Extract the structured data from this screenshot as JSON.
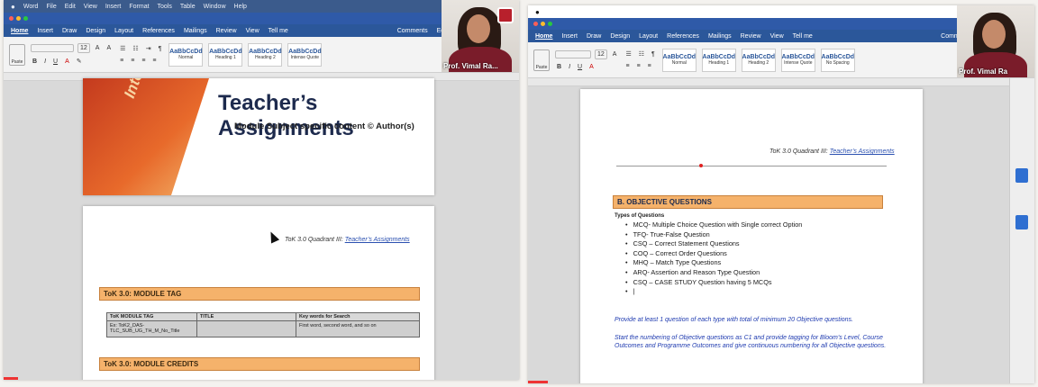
{
  "menubar": {
    "items": [
      "Word",
      "File",
      "Edit",
      "View",
      "Insert",
      "Format",
      "Tools",
      "Table",
      "Window",
      "Help"
    ]
  },
  "ribbon": {
    "tabs": [
      "Home",
      "Insert",
      "Draw",
      "Design",
      "Layout",
      "References",
      "Mailings",
      "Review",
      "View",
      "Tell me"
    ],
    "right": [
      "Comments",
      "Editing"
    ],
    "styles": [
      {
        "sample": "AaBbCcDd",
        "name": "Normal"
      },
      {
        "sample": "AaBbCcDd",
        "name": "Heading 1"
      },
      {
        "sample": "AaBbCcDd",
        "name": "Heading 2"
      },
      {
        "sample": "AaBbCcDd",
        "name": "Intense Quote"
      },
      {
        "sample": "AaBbCcDd",
        "name": "No Spacing"
      }
    ],
    "paste_label": "Paste",
    "font_size": "12"
  },
  "left": {
    "cover_word": "Integr",
    "title": "Teacher’s Assignments",
    "subtitle": "Module Subject specific content © Author(s)",
    "tok_link_prefix": "ToK 3.0 Quadrant III:",
    "tok_link_target": "Teacher’s Assignments",
    "module_tag_heading": "ToK 3.0: MODULE TAG",
    "table": {
      "headers": [
        "ToK MODULE TAG",
        "TITLE",
        "Key words for Search"
      ],
      "row": [
        "Ex: ToK2_DAS-TLC_SUB_UG_TH_M_No_Title",
        "",
        "First word, second word, and so on"
      ]
    },
    "credits_heading": "ToK 3.0: MODULE CREDITS",
    "webcam_name": "Prof. Vimal Ra..."
  },
  "right": {
    "tok_link_prefix": "ToK 3.0 Quadrant III:",
    "tok_link_target": "Teacher’s Assignments",
    "section_heading": "B. OBJECTIVE QUESTIONS",
    "types_label": "Types of Questions",
    "question_types": [
      "MCQ- Multiple Choice Question with Single correct Option",
      "TFQ- True-False Question",
      "CSQ – Correct Statement Questions",
      "COQ – Correct Order Questions",
      "MHQ – Match Type Questions",
      "ARQ- Assertion and Reason Type Question",
      "CSQ – CASE STUDY Question having 5 MCQs",
      "|"
    ],
    "para1": "Provide at least 1 question of each type with total of minimum 20 Objective questions.",
    "para2": "Start the numbering of Objective questions as C1 and provide tagging for Bloom’s Level, Course Outcomes and Programme Outcomes and give continuous numbering for all Objective questions.",
    "webcam_name": "Prof. Vimal Ra"
  },
  "colors": {
    "ribbon_blue": "#2b579a",
    "section_orange": "#f5b26b",
    "link_blue": "#1f3bb0"
  }
}
